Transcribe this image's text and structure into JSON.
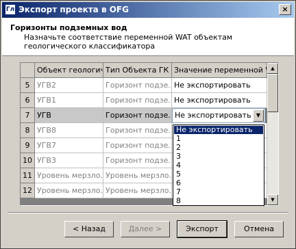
{
  "window": {
    "icon_text": "Гл",
    "title": "Экспорт проекта в OFG",
    "close_label": "×"
  },
  "header": {
    "title": "Горизонты подземных вод",
    "description": "Назначьте соответствие переменной WAT объектам геологического классификатора"
  },
  "grid": {
    "columns": [
      "Объект геологиче",
      "Тип Объекта ГК",
      "Значение переменной WA"
    ],
    "rows": [
      {
        "num": "5",
        "object": "УГВ2",
        "type": "Горизонт подзе...",
        "value": "Не экспортировать"
      },
      {
        "num": "6",
        "object": "УГВ1",
        "type": "Горизонт подзе...",
        "value": "Не экспортировать"
      },
      {
        "num": "7",
        "object": "УГВ",
        "type": "Горизонт подзе...",
        "value": "Не экспортировать"
      },
      {
        "num": "8",
        "object": "УГВ8",
        "type": "Горизонт подзе...",
        "value": ""
      },
      {
        "num": "9",
        "object": "УГВ7",
        "type": "Горизонт подзе...",
        "value": ""
      },
      {
        "num": "10",
        "object": "УГВ3",
        "type": "Горизонт подзе...",
        "value": ""
      },
      {
        "num": "11",
        "object": "Уровень мерзло...",
        "type": "Уровень мерзло...",
        "value": ""
      },
      {
        "num": "12",
        "object": "Уровень мерзло...",
        "type": "Уровень мерзло...",
        "value": ""
      }
    ]
  },
  "dropdown": {
    "options": [
      "Не экспортировать",
      "1",
      "2",
      "3",
      "4",
      "5",
      "6",
      "7",
      "8"
    ],
    "highlighted": "Не экспортировать"
  },
  "buttons": {
    "back": "< Назад",
    "next": "Далее >",
    "export": "Экспорт",
    "cancel": "Отмена"
  }
}
